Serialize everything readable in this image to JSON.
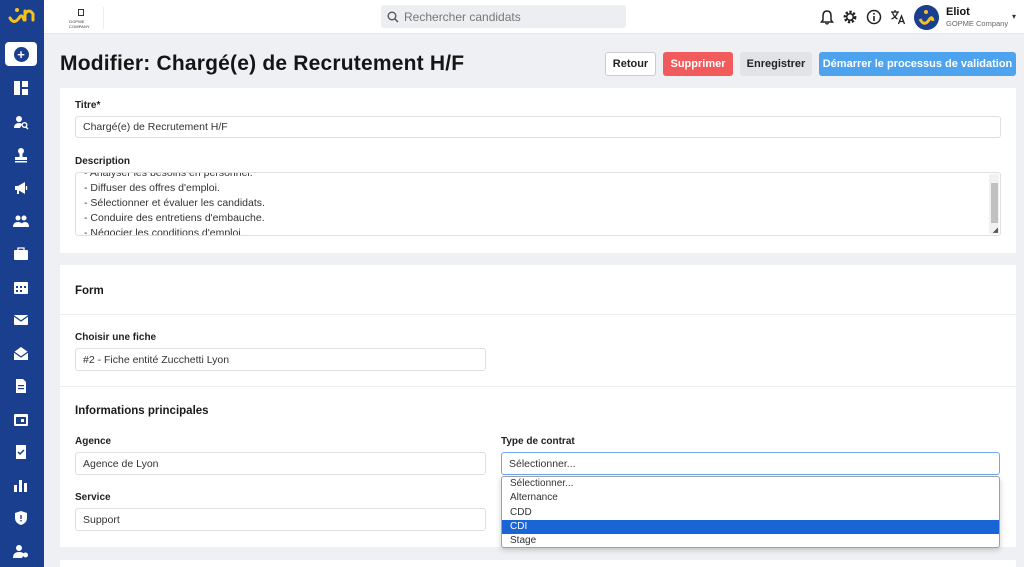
{
  "topbar": {
    "company_logo_text": "GOPME COMPANY",
    "search_placeholder": "Rechercher candidats",
    "user": {
      "name": "Eliot",
      "company": "GOPME Company"
    }
  },
  "header": {
    "title": "Modifier: Chargé(e) de Recrutement H/F",
    "buttons": {
      "back": "Retour",
      "delete": "Supprimer",
      "save": "Enregistrer",
      "start_validation": "Démarrer le processus de validation"
    }
  },
  "job": {
    "title_label": "Titre*",
    "title_value": "Chargé(e) de Recrutement H/F",
    "description_label": "Description",
    "description_lines": [
      "- Analyser les besoins en personnel.",
      "- Diffuser des offres d'emploi.",
      "- Sélectionner et évaluer les candidats.",
      "- Conduire des entretiens d'embauche.",
      "- Négocier les conditions d'emploi."
    ]
  },
  "form": {
    "section_title": "Form",
    "fiche_label": "Choisir une fiche",
    "fiche_value": "#2 - Fiche entité Zucchetti Lyon"
  },
  "main_info": {
    "section_title": "Informations principales",
    "agency_label": "Agence",
    "agency_value": "Agence de Lyon",
    "contract_label": "Type de contrat",
    "contract_value": "Sélectionner...",
    "service_label": "Service",
    "service_value": "Support",
    "contract_options": [
      "Sélectionner...",
      "Alternance",
      "CDD",
      "CDI",
      "Stage"
    ],
    "highlighted_option": "CDI"
  },
  "colors": {
    "sidebar": "#1a3f8e",
    "danger": "#f15b5b",
    "primary": "#4ea3ee",
    "highlight": "#1a65d6"
  }
}
